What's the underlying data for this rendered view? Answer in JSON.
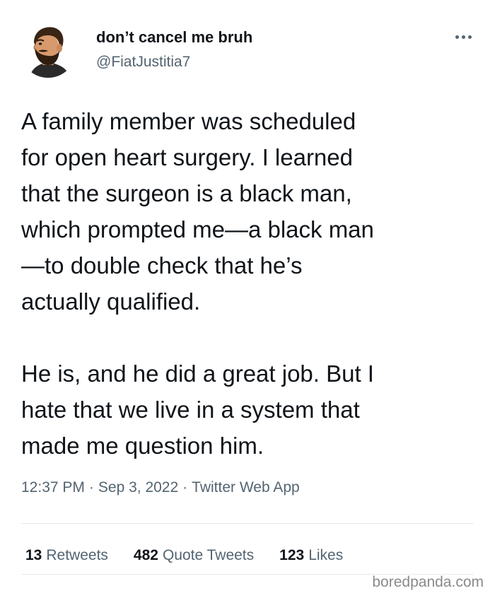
{
  "author": {
    "display_name": "don’t cancel me bruh",
    "handle": "@FiatJustitia7",
    "avatar": "bearded-man-avatar"
  },
  "tweet": {
    "paragraphs": [
      "A family member was scheduled\nfor open heart surgery. I learned\nthat the surgeon is a black man,\nwhich prompted me—a black man\n—to double check that he’s\nactually qualified.",
      "He is, and he did a great job. But I\nhate that we live in a system that\nmade me question him."
    ]
  },
  "meta": {
    "time": "12:37 PM",
    "separator": "·",
    "date": "Sep 3, 2022",
    "source": "Twitter Web App"
  },
  "stats": {
    "retweets_count": "13",
    "retweets_label": "Retweets",
    "quotes_count": "482",
    "quotes_label": "Quote Tweets",
    "likes_count": "123",
    "likes_label": "Likes"
  },
  "icons": {
    "more": "more-horizontal-icon"
  },
  "watermark": "boredpanda.com",
  "colors": {
    "text_primary": "#0f1419",
    "text_secondary": "#536471",
    "divider": "#e6eaed"
  }
}
